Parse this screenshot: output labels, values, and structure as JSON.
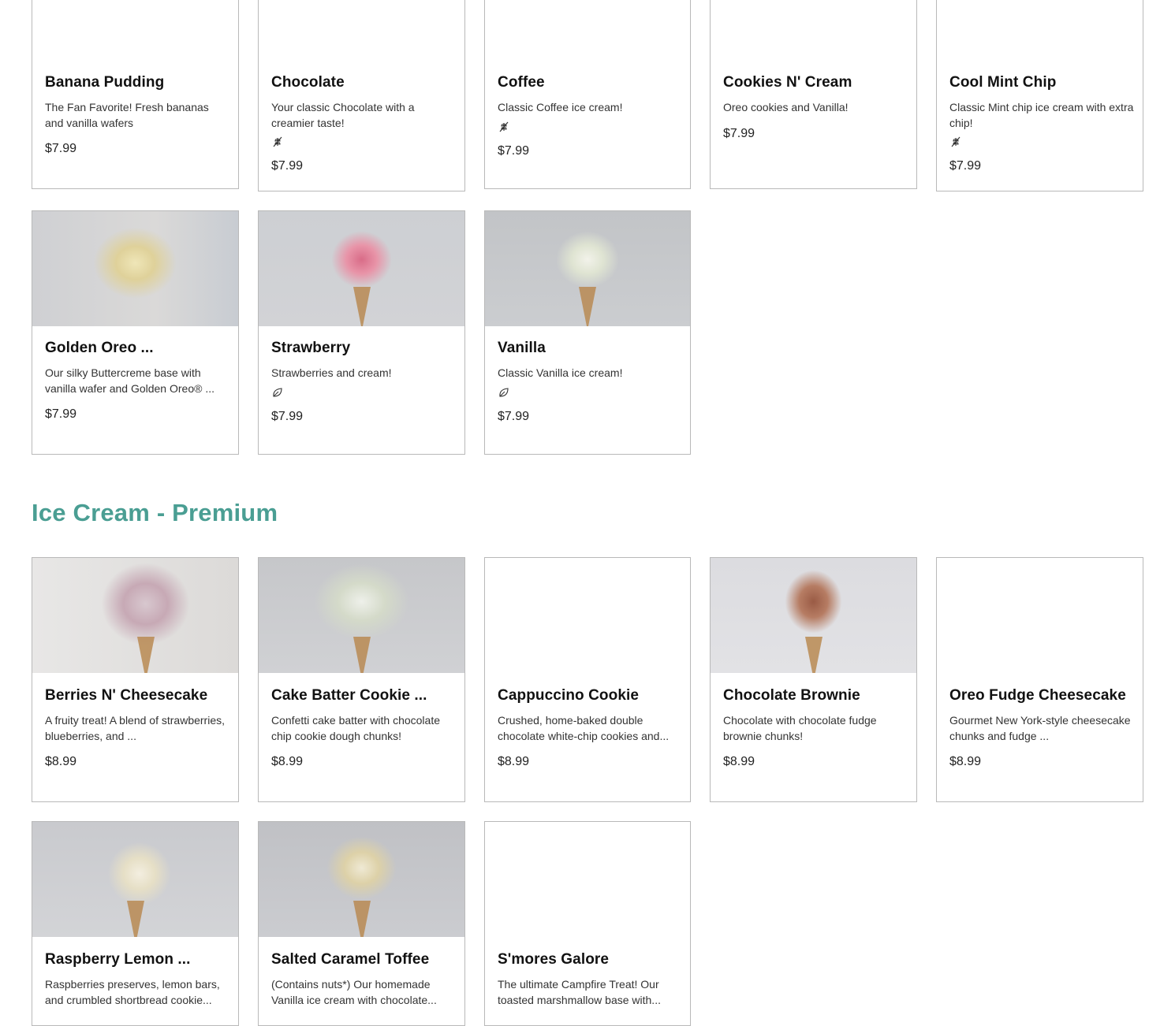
{
  "colors": {
    "section_heading": "#4a9e93",
    "card_border": "#b9b9b9"
  },
  "premium_section": {
    "heading": "Ice Cream - Premium"
  },
  "classic_items": [
    {
      "title": "Banana Pudding",
      "description": "The Fan Favorite! Fresh bananas and vanilla wafers",
      "price": "$7.99"
    },
    {
      "title": "Chocolate",
      "description": "Your classic Chocolate with a creamier taste!",
      "price": "$7.99",
      "icon": "gluten-free-icon"
    },
    {
      "title": "Coffee",
      "description": "Classic Coffee ice cream!",
      "price": "$7.99",
      "icon": "gluten-free-icon"
    },
    {
      "title": "Cookies N' Cream",
      "description": "Oreo cookies and Vanilla!",
      "price": "$7.99"
    },
    {
      "title": "Cool Mint Chip",
      "description": "Classic Mint chip ice cream with extra chip!",
      "price": "$7.99",
      "icon": "gluten-free-icon"
    },
    {
      "title": "Golden Oreo ...",
      "description": "Our silky Buttercreme base with vanilla wafer and Golden Oreo® ...",
      "price": "$7.99"
    },
    {
      "title": "Strawberry",
      "description": "Strawberries and cream!",
      "price": "$7.99",
      "icon": "vegetarian-leaf-icon"
    },
    {
      "title": "Vanilla",
      "description": "Classic Vanilla ice cream!",
      "price": "$7.99",
      "icon": "vegetarian-leaf-icon"
    }
  ],
  "premium_items": [
    {
      "title": "Berries N' Cheesecake",
      "description": "A fruity treat! A blend of strawberries, blueberries, and ...",
      "price": "$8.99"
    },
    {
      "title": "Cake Batter Cookie ...",
      "description": "Confetti cake batter with chocolate chip cookie dough chunks!",
      "price": "$8.99"
    },
    {
      "title": "Cappuccino Cookie",
      "description": "Crushed, home-baked double chocolate white-chip cookies and...",
      "price": "$8.99"
    },
    {
      "title": "Chocolate Brownie",
      "description": "Chocolate with chocolate fudge brownie chunks!",
      "price": "$8.99"
    },
    {
      "title": "Oreo Fudge Cheesecake",
      "description": "Gourmet New York-style cheesecake chunks and fudge ...",
      "price": "$8.99"
    },
    {
      "title": "Raspberry Lemon ...",
      "description": "Raspberries preserves, lemon bars, and crumbled shortbread cookie..."
    },
    {
      "title": "Salted Caramel Toffee",
      "description": "(Contains nuts*) Our homemade Vanilla ice cream with chocolate..."
    },
    {
      "title": "S'mores Galore",
      "description": "The ultimate Campfire Treat! Our toasted marshmallow base with..."
    }
  ]
}
